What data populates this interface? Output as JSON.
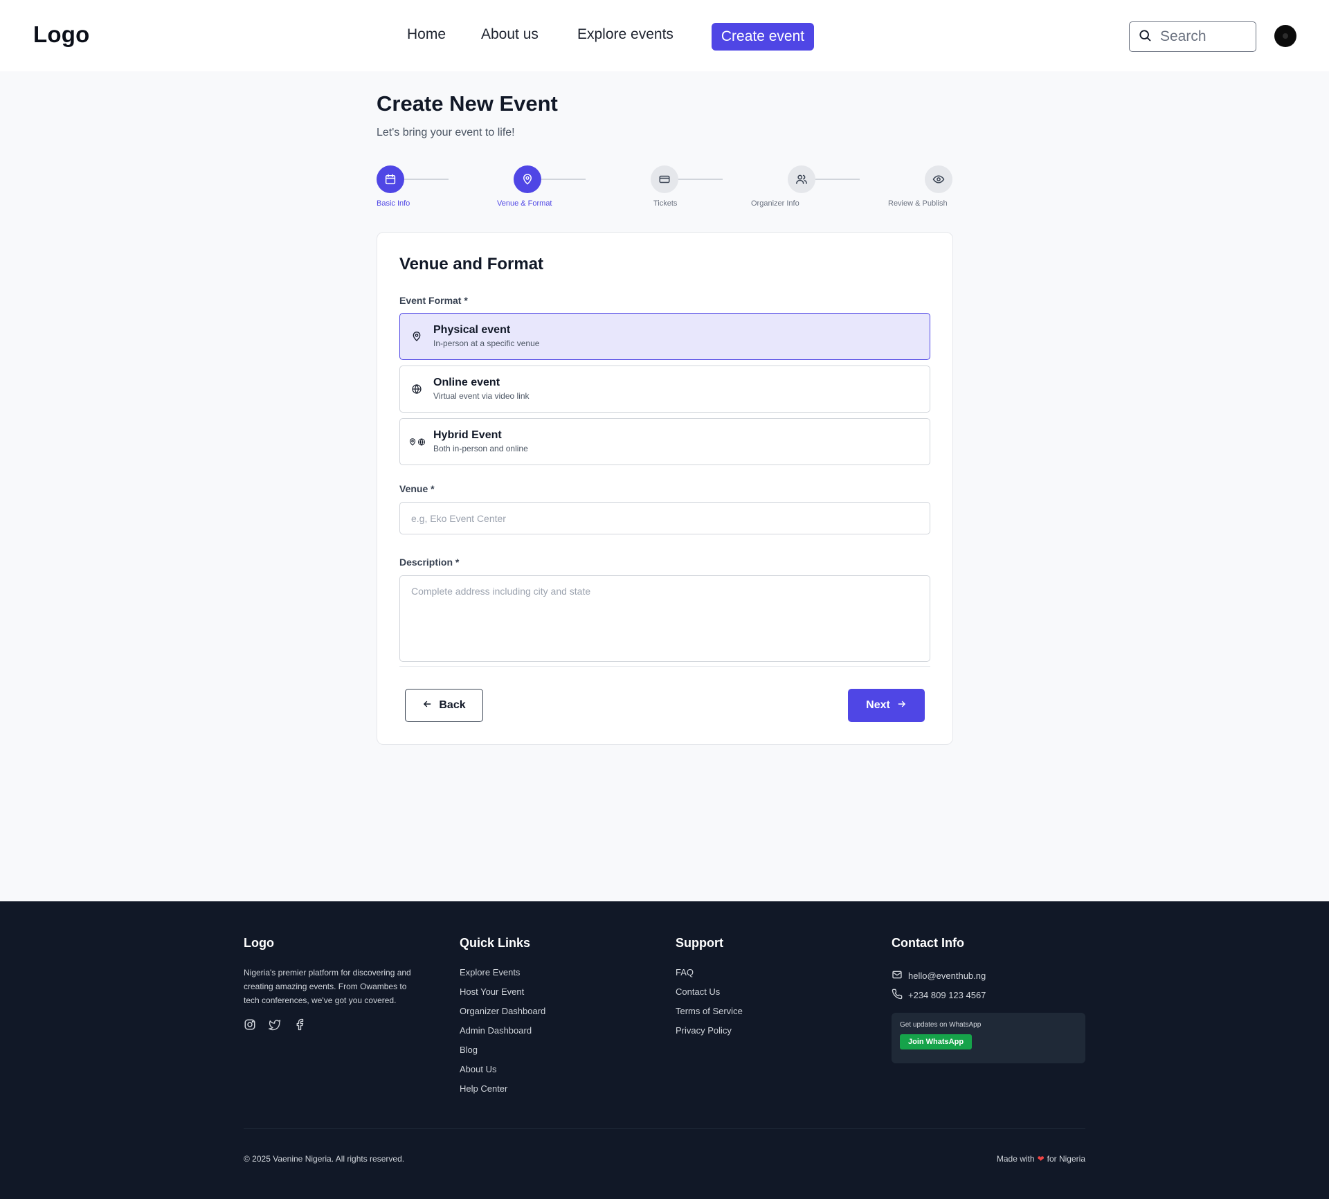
{
  "header": {
    "logo": "Logo",
    "nav": [
      "Home",
      "About us",
      "Explore events"
    ],
    "cta": "Create event",
    "search_placeholder": "Search"
  },
  "page": {
    "title": "Create New Event",
    "subtitle": "Let's bring your event to life!"
  },
  "stepper": {
    "steps": [
      {
        "label": "Basic Info",
        "icon": "calendar-icon",
        "active": true
      },
      {
        "label": "Venue & Format",
        "icon": "map-pin-icon",
        "active": true
      },
      {
        "label": "Tickets",
        "icon": "ticket-icon",
        "active": false
      },
      {
        "label": "Organizer Info",
        "icon": "users-icon",
        "active": false
      },
      {
        "label": "Review & Publish",
        "icon": "eye-icon",
        "active": false
      }
    ]
  },
  "form": {
    "title": "Venue and Format",
    "format_label": "Event Format *",
    "options": [
      {
        "title": "Physical event",
        "desc": "In-person at a specific venue",
        "selected": true
      },
      {
        "title": "Online event",
        "desc": "Virtual event via video link",
        "selected": false
      },
      {
        "title": "Hybrid Event",
        "desc": "Both in-person and online",
        "selected": false
      }
    ],
    "venue_label": "Venue *",
    "venue_placeholder": "e.g, Eko Event Center",
    "venue_value": "",
    "description_label": "Description *",
    "description_placeholder": "Complete address including city and state",
    "description_value": "",
    "back_label": "Back",
    "next_label": "Next"
  },
  "footer": {
    "logo": "Logo",
    "about": "Nigeria's premier platform for discovering and creating amazing events. From Owambes to tech conferences, we've got you covered.",
    "quick_links_title": "Quick Links",
    "quick_links": [
      "Explore Events",
      "Host Your Event",
      "Organizer Dashboard",
      "Admin Dashboard",
      "Blog",
      "About Us",
      "Help Center"
    ],
    "support_title": "Support",
    "support_links": [
      "FAQ",
      "Contact Us",
      "Terms of Service",
      "Privacy Policy"
    ],
    "contact_title": "Contact Info",
    "email": "hello@eventhub.ng",
    "phone": "+234 809 123 4567",
    "whatsapp_text": "Get updates on WhatsApp",
    "whatsapp_button": "Join WhatsApp",
    "copyright": "© 2025 Vaenine Nigeria. All rights reserved.",
    "made_with_prefix": "Made with",
    "made_with_suffix": "for Nigeria"
  },
  "colors": {
    "accent": "#4f46e5",
    "footer_bg": "#111827",
    "whatsapp": "#16a34a",
    "selected_option_bg": "#e8e7fc"
  }
}
